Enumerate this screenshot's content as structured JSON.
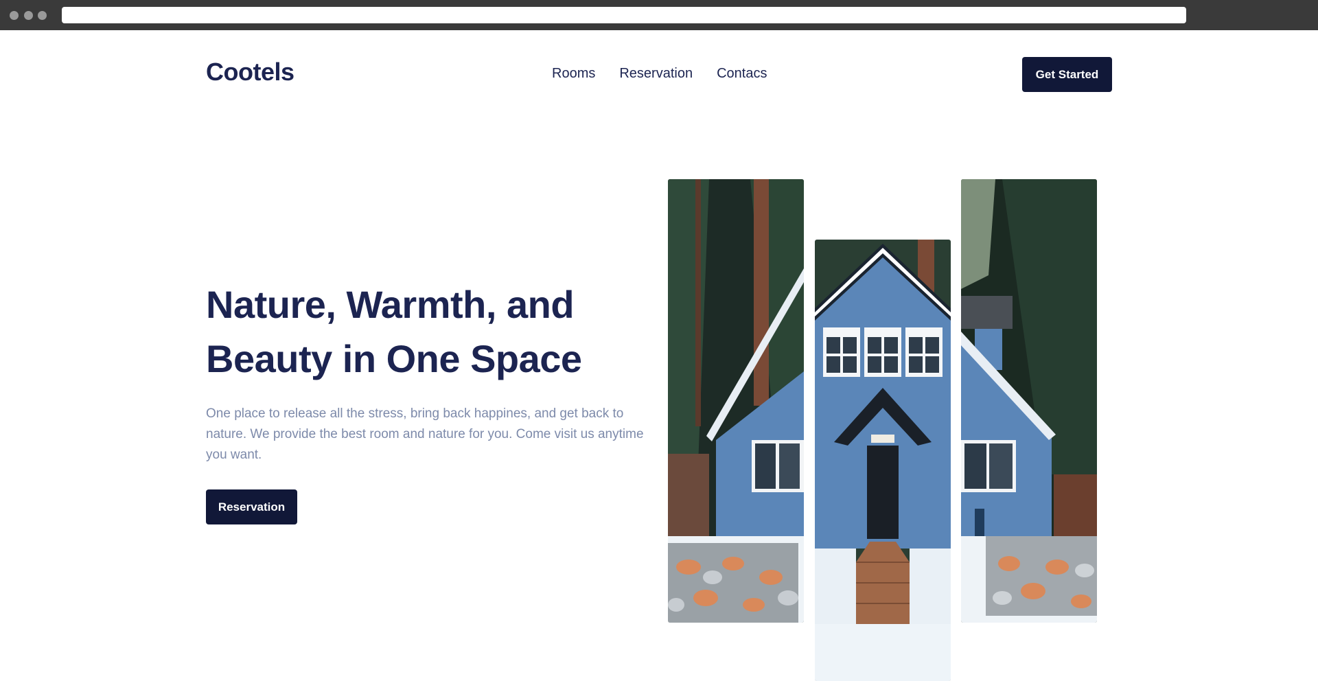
{
  "brand": {
    "name": "Cootels"
  },
  "nav": {
    "items": [
      {
        "label": "Rooms"
      },
      {
        "label": "Reservation"
      },
      {
        "label": "Contacs"
      }
    ],
    "cta_label": "Get Started"
  },
  "hero": {
    "title": "Nature, Warmth, and Beauty in One Space",
    "subtitle": "One place to release all the stress, bring back happines, and get back to nature. We provide the best room and nature for you. Come visit us anytime you want.",
    "button_label": "Reservation",
    "images": [
      {
        "name": "cabin-left-strip"
      },
      {
        "name": "cabin-center-strip"
      },
      {
        "name": "cabin-right-strip"
      }
    ]
  },
  "colors": {
    "brand_dark": "#1c2451",
    "button_bg": "#111838",
    "muted_text": "#7d8aaa",
    "cabin_blue": "#5b86b8"
  }
}
